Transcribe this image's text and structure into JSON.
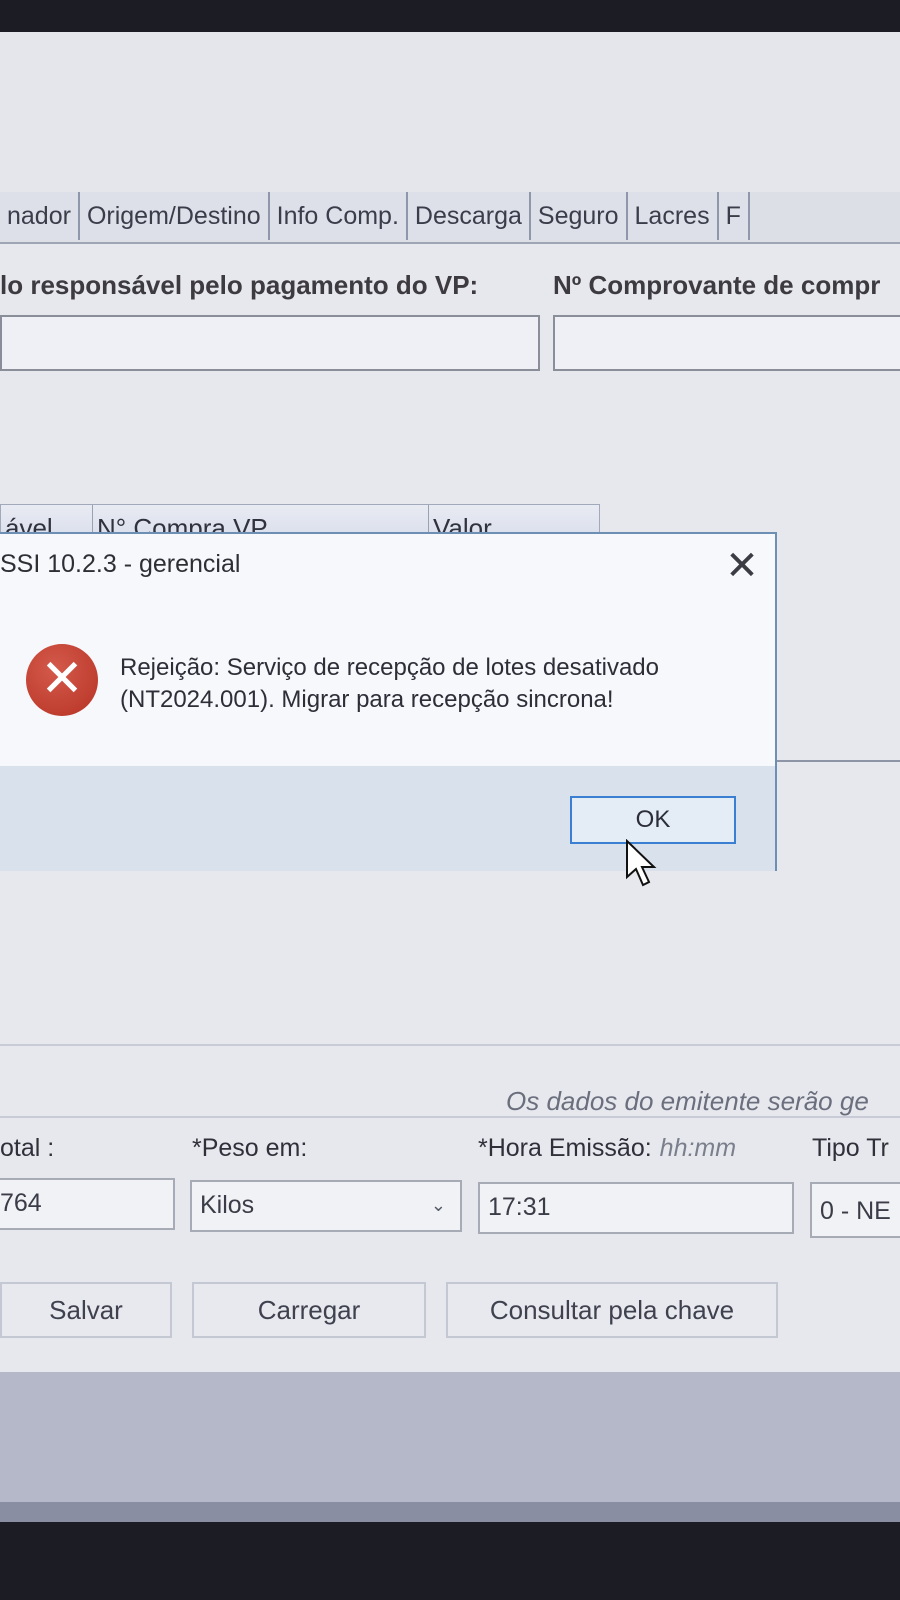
{
  "tabs": [
    "nador",
    "Origem/Destino",
    "Info Comp.",
    "Descarga",
    "Seguro",
    "Lacres",
    "F"
  ],
  "vp_section": {
    "responsible_label": "lo responsável pelo pagamento do VP:",
    "receipt_label": "Nº Comprovante de compr"
  },
  "vp_table": {
    "columns": [
      "ável VP",
      "N° Compra VP",
      "Valor"
    ]
  },
  "dialog": {
    "title": "SSI 10.2.3 - gerencial",
    "close_glyph": "✕",
    "icon_glyph": "✕",
    "message": "Rejeição: Serviço de recepção de lotes desativado (NT2024.001). Migrar para recepção sincrona!",
    "ok_label": "OK"
  },
  "form": {
    "info_text": "Os dados do emitente serão ge",
    "total_label": "otal :",
    "total_value": "764",
    "peso_label": "*Peso em:",
    "peso_value": "Kilos",
    "hora_label": "*Hora Emissão:",
    "hora_hint": "hh:mm",
    "hora_value": "17:31",
    "tipo_label": "Tipo Tr",
    "tipo_value": "0 - NE"
  },
  "buttons": {
    "salvar": "Salvar",
    "carregar": "Carregar",
    "consultar": "Consultar pela chave"
  },
  "colors": {
    "dialog_border": "#6d8fb3",
    "error_red": "#b63224",
    "ok_focus": "#3a7fd1",
    "table_selection": "#2f7ad8"
  }
}
